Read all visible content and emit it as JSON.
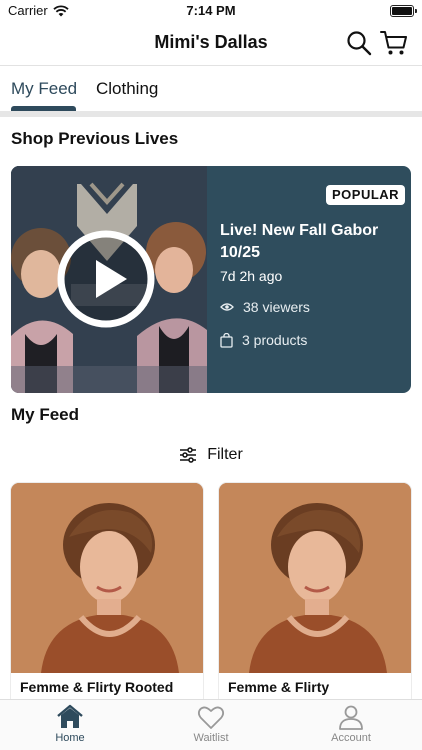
{
  "status_bar": {
    "carrier": "Carrier",
    "time": "7:14 PM"
  },
  "nav": {
    "title": "Mimi's Dallas",
    "search_icon": "search-icon",
    "cart_icon": "cart-icon"
  },
  "tabs": [
    {
      "label": "My Feed",
      "active": true
    },
    {
      "label": "Clothing",
      "active": false
    }
  ],
  "sections": {
    "previous_lives": "Shop Previous Lives",
    "my_feed": "My Feed"
  },
  "live_card": {
    "badge": "POPULAR",
    "title": "Live! New Fall Gabor 10/25",
    "ago": "7d 2h ago",
    "viewers": "38 viewers",
    "products": "3 products"
  },
  "filter": {
    "label": "Filter"
  },
  "products": [
    {
      "name": "Femme & Flirty Rooted"
    },
    {
      "name": "Femme & Flirty"
    }
  ],
  "tab_bar": [
    {
      "label": "Home"
    },
    {
      "label": "Waitlist"
    },
    {
      "label": "Account"
    }
  ],
  "colors": {
    "accent": "#2e4a5c",
    "live_card_bg": "#2f4d5d",
    "product_bg": "#c4875a"
  }
}
